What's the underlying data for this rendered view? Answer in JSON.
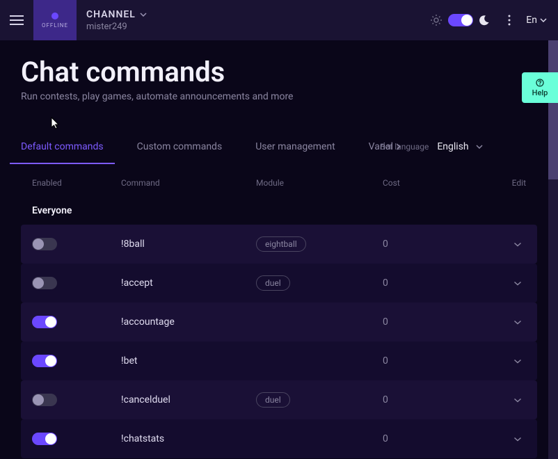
{
  "header": {
    "channel_label": "CHANNEL",
    "channel_status": "OFFLINE",
    "channel_user": "mister249",
    "lang": "En"
  },
  "help": {
    "label": "Help"
  },
  "page": {
    "title": "Chat commands",
    "subtitle": "Run contests, play games, automate announcements and more"
  },
  "tabs": {
    "default": "Default commands",
    "custom": "Custom commands",
    "user_mgmt": "User management",
    "variables_truncated": "Varial",
    "bot_lang_label": "Bot language",
    "bot_lang_value": "English"
  },
  "table": {
    "headers": {
      "enabled": "Enabled",
      "command": "Command",
      "module": "Module",
      "cost": "Cost",
      "edit": "Edit"
    },
    "group": "Everyone",
    "rows": [
      {
        "enabled": false,
        "command": "!8ball",
        "module": "eightball",
        "cost": "0"
      },
      {
        "enabled": false,
        "command": "!accept",
        "module": "duel",
        "cost": "0"
      },
      {
        "enabled": true,
        "command": "!accountage",
        "module": "",
        "cost": "0"
      },
      {
        "enabled": true,
        "command": "!bet",
        "module": "",
        "cost": "0"
      },
      {
        "enabled": false,
        "command": "!cancelduel",
        "module": "duel",
        "cost": "0"
      },
      {
        "enabled": true,
        "command": "!chatstats",
        "module": "",
        "cost": "0"
      }
    ]
  }
}
